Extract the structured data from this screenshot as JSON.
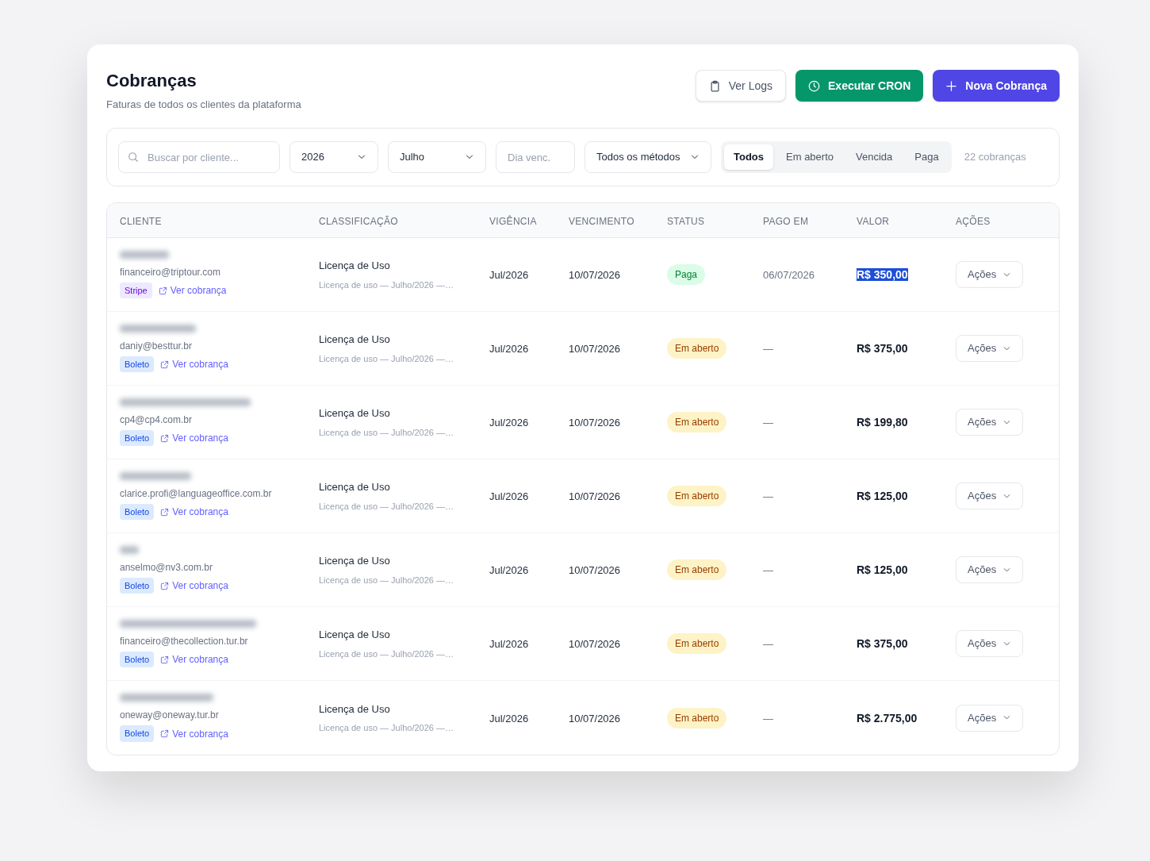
{
  "page": {
    "title": "Cobranças",
    "subtitle": "Faturas de todos os clientes da plataforma"
  },
  "header_buttons": [
    {
      "label": "Ver Logs",
      "kind": "outline"
    },
    {
      "label": "Executar CRON",
      "kind": "success"
    },
    {
      "label": "Nova Cobrança",
      "kind": "primary"
    }
  ],
  "filters": {
    "search": {
      "placeholder": "Buscar por cliente..."
    },
    "year": {
      "value": "2026"
    },
    "month": {
      "value": "Julho"
    },
    "due_day": {
      "placeholder": "Dia venc."
    },
    "method": {
      "value": "Todos os métodos"
    },
    "status_tabs": [
      {
        "label": "Todos",
        "selected": true
      },
      {
        "label": "Em aberto",
        "selected": false
      },
      {
        "label": "Vencida",
        "selected": false
      },
      {
        "label": "Paga",
        "selected": false
      }
    ],
    "count": "22 cobranças"
  },
  "table": {
    "columns": [
      "CLIENTE",
      "CLASSIFICAÇÃO",
      "VIGÊNCIA",
      "VENCIMENTO",
      "STATUS",
      "PAGO EM",
      "VALOR",
      "AÇÕES"
    ],
    "rows": [
      {
        "name_blurred": true,
        "email": "financeiro@triptour.com",
        "method": {
          "label": "Stripe",
          "kind": "stripe"
        },
        "link": "Ver cobrança",
        "classification": "Licença de Uso",
        "description": "Licença de uso — Julho/2026 —…",
        "period": "Jul/2026",
        "due_date": "10/07/2026",
        "status": {
          "label": "Paga",
          "kind": "paid"
        },
        "paid_on": "06/07/2026",
        "value": "R$ 350,00",
        "value_selected": true,
        "action": "Ações"
      },
      {
        "name_blurred": true,
        "email": "daniy@besttur.br",
        "method": {
          "label": "Boleto",
          "kind": "boleto"
        },
        "link": "Ver cobrança",
        "classification": "Licença de Uso",
        "description": "Licença de uso — Julho/2026 —…",
        "period": "Jul/2026",
        "due_date": "10/07/2026",
        "status": {
          "label": "Em aberto",
          "kind": "open"
        },
        "paid_on": "—",
        "value": "R$ 375,00",
        "value_selected": false,
        "action": "Ações"
      },
      {
        "name_blurred": true,
        "email": "cp4@cp4.com.br",
        "method": {
          "label": "Boleto",
          "kind": "boleto"
        },
        "link": "Ver cobrança",
        "classification": "Licença de Uso",
        "description": "Licença de uso — Julho/2026 —…",
        "period": "Jul/2026",
        "due_date": "10/07/2026",
        "status": {
          "label": "Em aberto",
          "kind": "open"
        },
        "paid_on": "—",
        "value": "R$ 199,80",
        "value_selected": false,
        "action": "Ações"
      },
      {
        "name_blurred": true,
        "email": "clarice.profi@languageoffice.com.br",
        "method": {
          "label": "Boleto",
          "kind": "boleto"
        },
        "link": "Ver cobrança",
        "classification": "Licença de Uso",
        "description": "Licença de uso — Julho/2026 —…",
        "period": "Jul/2026",
        "due_date": "10/07/2026",
        "status": {
          "label": "Em aberto",
          "kind": "open"
        },
        "paid_on": "—",
        "value": "R$ 125,00",
        "value_selected": false,
        "action": "Ações"
      },
      {
        "name_blurred": true,
        "email": "anselmo@nv3.com.br",
        "method": {
          "label": "Boleto",
          "kind": "boleto"
        },
        "link": "Ver cobrança",
        "classification": "Licença de Uso",
        "description": "Licença de uso — Julho/2026 —…",
        "period": "Jul/2026",
        "due_date": "10/07/2026",
        "status": {
          "label": "Em aberto",
          "kind": "open"
        },
        "paid_on": "—",
        "value": "R$ 125,00",
        "value_selected": false,
        "action": "Ações"
      },
      {
        "name_blurred": true,
        "email": "financeiro@thecollection.tur.br",
        "method": {
          "label": "Boleto",
          "kind": "boleto"
        },
        "link": "Ver cobrança",
        "classification": "Licença de Uso",
        "description": "Licença de uso — Julho/2026 —…",
        "period": "Jul/2026",
        "due_date": "10/07/2026",
        "status": {
          "label": "Em aberto",
          "kind": "open"
        },
        "paid_on": "—",
        "value": "R$ 375,00",
        "value_selected": false,
        "action": "Ações"
      },
      {
        "name_blurred": true,
        "email": "oneway@oneway.tur.br",
        "method": {
          "label": "Boleto",
          "kind": "boleto"
        },
        "link": "Ver cobrança",
        "classification": "Licença de Uso",
        "description": "Licença de uso — Julho/2026 —…",
        "period": "Jul/2026",
        "due_date": "10/07/2026",
        "status": {
          "label": "Em aberto",
          "kind": "open"
        },
        "paid_on": "—",
        "value": "R$ 2.775,00",
        "value_selected": false,
        "action": "Ações"
      }
    ]
  }
}
